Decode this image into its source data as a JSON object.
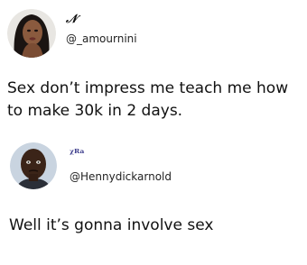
{
  "tweets": [
    {
      "display_name": "𝒩",
      "handle": "@_amournini",
      "text": "Sex don’t impress me teach me how to make 30k in 2 days."
    },
    {
      "display_name": "ᵡᴿᵃ",
      "handle": "@Hennydickarnold",
      "text": "Well it’s gonna involve sex"
    }
  ]
}
